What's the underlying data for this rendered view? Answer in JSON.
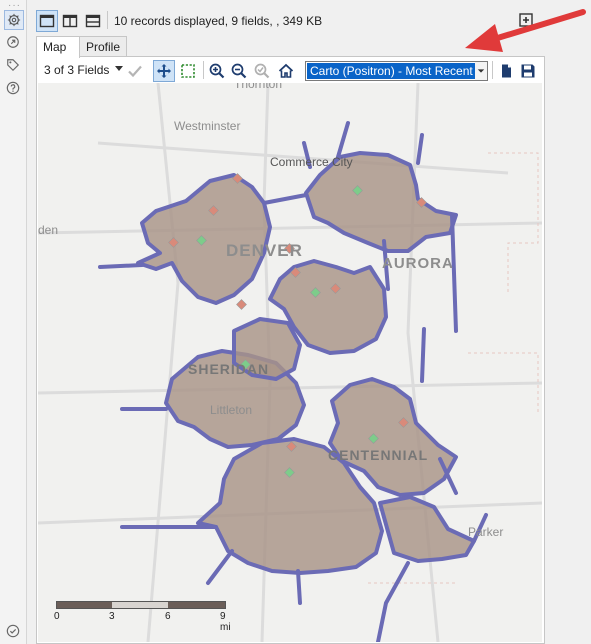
{
  "status": {
    "records_text": "10 records displayed, 9 fields, , 349 KB"
  },
  "tabs": [
    {
      "label": "Map"
    },
    {
      "label": "Profile"
    }
  ],
  "toolbar": {
    "fields_label": "3 of 3 Fields",
    "basemap_value": "Carto (Positron) - Most Recent"
  },
  "map": {
    "place_labels": [
      "Thornton",
      "Westminster",
      "Commerce City",
      "DENVER",
      "AURORA",
      "SHERIDAN",
      "Littleton",
      "CENTENNIAL",
      "Parker",
      "den"
    ],
    "scale": {
      "ticks": [
        "0",
        "3",
        "6",
        "9 mi"
      ]
    }
  },
  "colors": {
    "region_fill": "#a89488",
    "region_stroke": "#6b6bb5",
    "point_red": "#d98a7a",
    "point_green": "#7dcc8a",
    "arrow": "#e03a3a",
    "selection": "#0a64c8"
  }
}
